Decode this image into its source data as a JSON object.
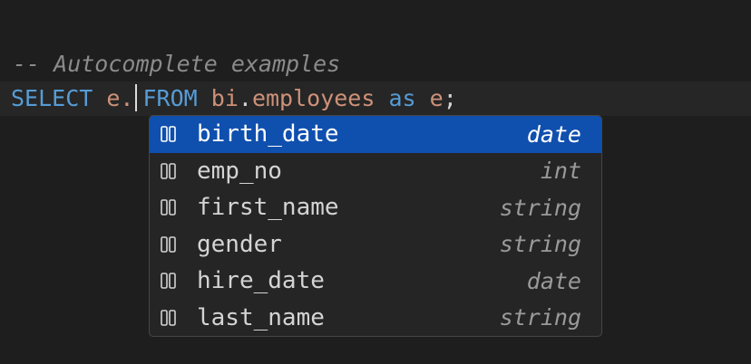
{
  "editor": {
    "comment": "-- Autocomplete examples",
    "code": {
      "select": "SELECT",
      "alias_prefix": "e.",
      "from": "FROM",
      "schema": "bi",
      "dot": ".",
      "table": "employees",
      "as": "as",
      "alias": "e",
      "semicolon": ";"
    }
  },
  "suggestions": [
    {
      "label": "birth_date",
      "type": "date",
      "icon": "field-icon",
      "selected": true
    },
    {
      "label": "emp_no",
      "type": "int",
      "icon": "field-icon",
      "selected": false
    },
    {
      "label": "first_name",
      "type": "string",
      "icon": "field-icon",
      "selected": false
    },
    {
      "label": "gender",
      "type": "string",
      "icon": "field-icon",
      "selected": false
    },
    {
      "label": "hire_date",
      "type": "date",
      "icon": "field-icon",
      "selected": false
    },
    {
      "label": "last_name",
      "type": "string",
      "icon": "field-icon",
      "selected": false
    }
  ],
  "colors": {
    "background": "#1e1e1e",
    "current_line": "#262626",
    "keyword": "#569cd6",
    "identifier": "#ce9178",
    "comment": "#8b8b8b",
    "selection": "#0f4fae"
  }
}
